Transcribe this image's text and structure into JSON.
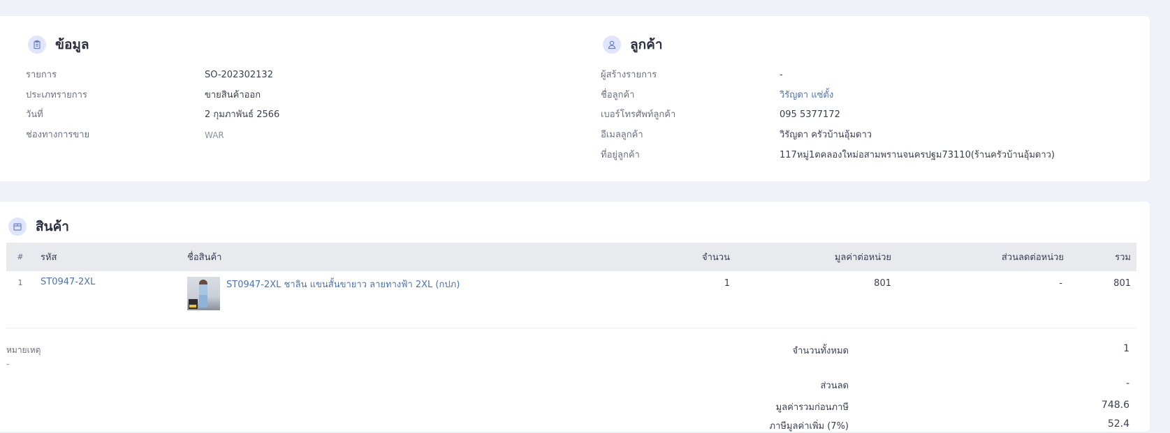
{
  "info": {
    "title": "ข้อมูล",
    "icon": "clipboard-icon",
    "rows": [
      {
        "label": "รายการ",
        "value": "SO-202302132"
      },
      {
        "label": "ประเภทรายการ",
        "value": "ขายสินค้าออก"
      },
      {
        "label": "วันที่",
        "value": "2 กุมภาพันธ์ 2566"
      },
      {
        "label": "ช่องทางการขาย",
        "value": "WAR"
      }
    ]
  },
  "customer": {
    "title": "ลูกค้า",
    "icon": "user-icon",
    "rows": [
      {
        "label": "ผู้สร้างรายการ",
        "value": "-"
      },
      {
        "label": "ชื่อลูกค้า",
        "value": "วิรัญดา แซ่ตั้ง"
      },
      {
        "label": "เบอร์โทรศัพท์ลูกค้า",
        "value": "095 5377172"
      },
      {
        "label": "อีเมลลูกค้า",
        "value": "วิรัญดา ครัวบ้านอุ้มดาว"
      },
      {
        "label": "ที่อยู่ลูกค้า",
        "value": "117หมู่1ตคลองใหม่อสามพรานจนครปฐม73110(ร้านครัวบ้านอุ้มดาว)"
      }
    ]
  },
  "products": {
    "title": "สินค้า",
    "icon": "box-icon",
    "columns": {
      "index": "#",
      "code": "รหัส",
      "name": "ชื่อสินค้า",
      "qty": "จำนวน",
      "unit_price": "มูลค่าต่อหน่วย",
      "unit_discount": "ส่วนลดต่อหน่วย",
      "total": "รวม"
    },
    "items": [
      {
        "index": "1",
        "code": "ST0947-2XL",
        "name": "ST0947-2XL ชาลิน แขนสั้นขายาว ลายทางฟ้า 2XL (กปภ)",
        "qty": "1",
        "unit_price": "801",
        "unit_discount": "-",
        "total": "801"
      }
    ]
  },
  "note": {
    "label": "หมายเหตุ",
    "value": "-"
  },
  "summary": {
    "total_qty_label": "จำนวนทั้งหมด",
    "total_qty": "1",
    "discount_label": "ส่วนลด",
    "discount": "-",
    "pre_tax_label": "มูลค่ารวมก่อนภาษี",
    "pre_tax": "748.6",
    "vat_label": "ภาษีมูลค่าเพิ่ม (7%)",
    "vat": "52.4"
  }
}
